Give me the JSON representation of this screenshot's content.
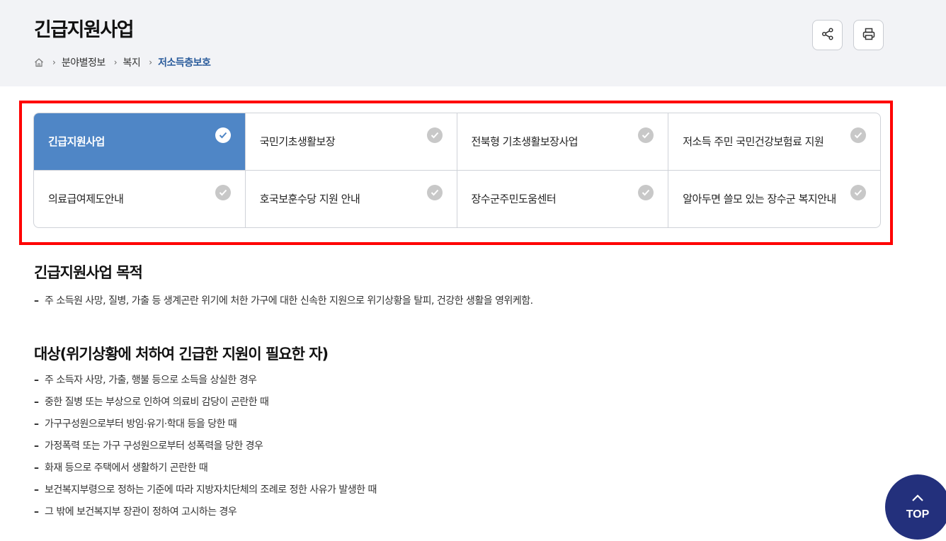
{
  "header": {
    "title": "긴급지원사업",
    "breadcrumb": [
      "분야별정보",
      "복지",
      "저소득층보호"
    ],
    "share_icon": "share-icon",
    "print_icon": "print-icon"
  },
  "tabs": [
    {
      "label": "긴급지원사업",
      "active": true
    },
    {
      "label": "국민기초생활보장",
      "active": false
    },
    {
      "label": "전북형 기초생활보장사업",
      "active": false
    },
    {
      "label": "저소득 주민 국민건강보험료 지원",
      "active": false
    },
    {
      "label": "의료급여제도안내",
      "active": false
    },
    {
      "label": "호국보훈수당 지원 안내",
      "active": false
    },
    {
      "label": "장수군주민도움센터",
      "active": false
    },
    {
      "label": "알아두면 쓸모 있는 장수군 복지안내",
      "active": false
    }
  ],
  "sections": [
    {
      "title": "긴급지원사업 목적",
      "items": [
        "주 소득원 사망, 질병, 가출 등 생계곤란 위기에 처한 가구에 대한 신속한 지원으로 위기상황을 탈피, 건강한 생활을 영위케함."
      ]
    },
    {
      "title": "대상(위기상황에 처하여 긴급한 지원이 필요한 자)",
      "items": [
        "주 소득자 사망, 가출, 행불 등으로 소득을 상실한 경우",
        "중한 질병 또는 부상으로 인하여 의료비 감당이 곤란한 때",
        "가구구성원으로부터 방임·유기·학대 등을 당한 때",
        "가정폭력 또는 가구 구성원으로부터 성폭력을 당한 경우",
        "화재 등으로 주택에서 생활하기 곤란한 때",
        "보건복지부령으로 정하는 기준에 따라 지방자치단체의 조례로 정한 사유가 발생한 때",
        "그 밖에 보건복지부 장관이 정하여 고시하는 경우"
      ]
    }
  ],
  "list_marker": "–",
  "top_button": {
    "label": "TOP"
  },
  "colors": {
    "active_tab": "#4f86c6",
    "highlight_border": "#ff0000",
    "top_button": "#23307c",
    "breadcrumb_current": "#2a5b9b",
    "header_bg": "#f2f3f6"
  }
}
